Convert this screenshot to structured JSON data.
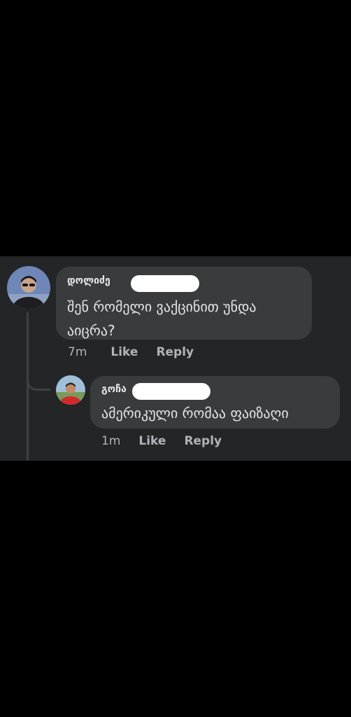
{
  "comments": [
    {
      "author": "დოლიძე",
      "text": "შენ რომელი ვაქცინით უნდა აიცრა?",
      "text_line1": "შენ რომელი ვაქცინით უნდა",
      "text_line2": "აიცრა?",
      "time": "7m",
      "like_label": "Like",
      "reply_label": "Reply"
    },
    {
      "author": "გოჩა",
      "text": "ამერიკული რომაა ფაიზაღი",
      "time": "1m",
      "like_label": "Like",
      "reply_label": "Reply"
    }
  ],
  "colors": {
    "panel_bg": "#242526",
    "bubble_bg": "#3a3b3c",
    "text": "#e4e6eb",
    "secondary_text": "#b0b3b8"
  }
}
